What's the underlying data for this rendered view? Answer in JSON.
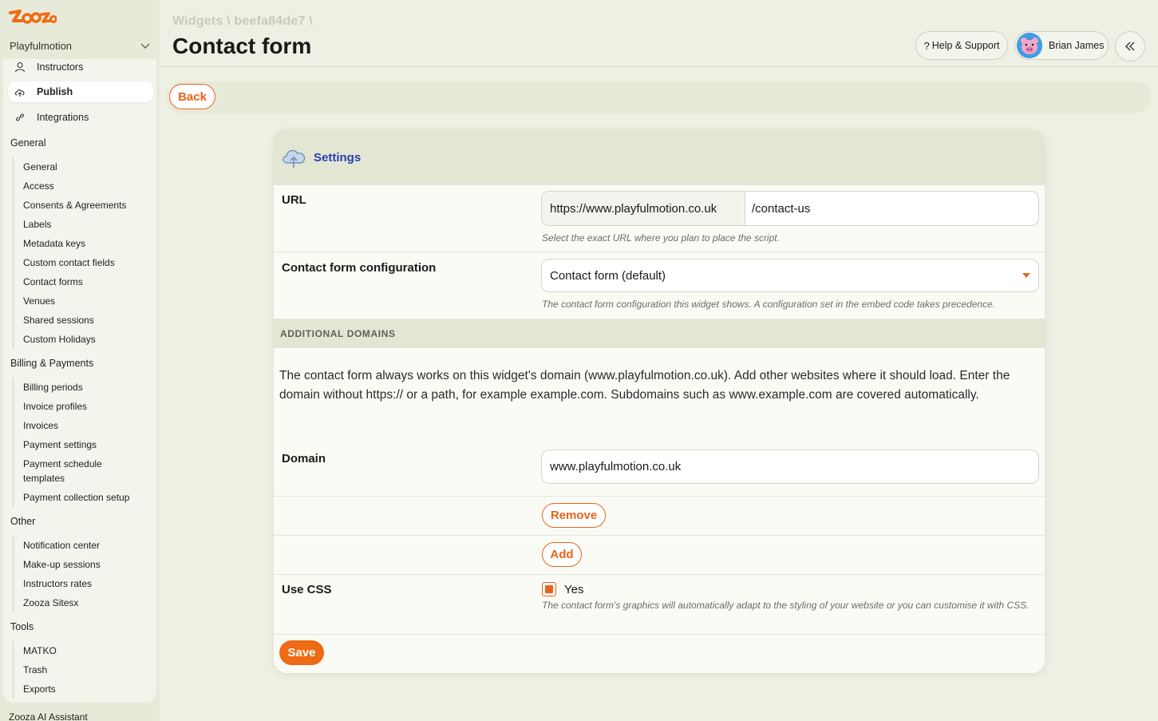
{
  "sidebar": {
    "logo_text": "Zooza",
    "org": "Playfulmotion",
    "items": [
      {
        "label": "Instructors",
        "icon": "user-icon"
      },
      {
        "label": "Publish",
        "icon": "cloud-upload-icon"
      },
      {
        "label": "Integrations",
        "icon": "link-icon"
      }
    ],
    "sections": [
      {
        "title": "General",
        "items": [
          "General",
          "Access",
          "Consents & Agreements",
          "Labels",
          "Metadata keys",
          "Custom contact fields",
          "Contact forms",
          "Venues",
          "Shared sessions",
          "Custom Holidays"
        ]
      },
      {
        "title": "Billing & Payments",
        "items": [
          "Billing periods",
          "Invoice profiles",
          "Invoices",
          "Payment settings",
          "Payment schedule templates",
          "Payment collection setup"
        ]
      },
      {
        "title": "Other",
        "items": [
          "Notification center",
          "Make-up sessions",
          "Instructors rates",
          "Zooza Sitesx"
        ]
      },
      {
        "title": "Tools",
        "items": [
          "MATKO",
          "Trash",
          "Exports"
        ]
      }
    ],
    "ai_assistant": "Zooza AI Assistant"
  },
  "header": {
    "breadcrumb": "Widgets \\ beefa84de7 \\",
    "title": "Contact form",
    "help_label": "Help & Support",
    "user_name": "Brian James"
  },
  "back_label": "Back",
  "card": {
    "title": "Settings",
    "url_label": "URL",
    "url_prefix": "https://www.playfulmotion.co.uk",
    "url_path": "/contact-us",
    "url_hint": "Select the exact URL where you plan to place the script.",
    "config_label": "Contact form configuration",
    "config_value": "Contact form (default)",
    "config_hint": "The contact form configuration this widget shows. A configuration set in the embed code takes precedence.",
    "additional_domains_title": "ADDITIONAL DOMAINS",
    "additional_domains_desc": "The contact form always works on this widget's domain (www.playfulmotion.co.uk). Add other websites where it should load. Enter the domain without https:// or a path, for example example.com. Subdomains such as www.example.com are covered automatically.",
    "domain_label": "Domain",
    "domain_value": "www.playfulmotion.co.uk",
    "remove_label": "Remove",
    "add_label": "Add",
    "use_css_label": "Use CSS",
    "use_css_value": "Yes",
    "use_css_checked": true,
    "use_css_hint": "The contact form's graphics will automatically adapt to the styling of your website or you can customise it with CSS.",
    "save_label": "Save"
  },
  "colors": {
    "accent": "#e8641a",
    "link_title": "#2a3eb0",
    "sidebar_bg": "#e8ead9",
    "page_bg": "#eef0e3"
  }
}
